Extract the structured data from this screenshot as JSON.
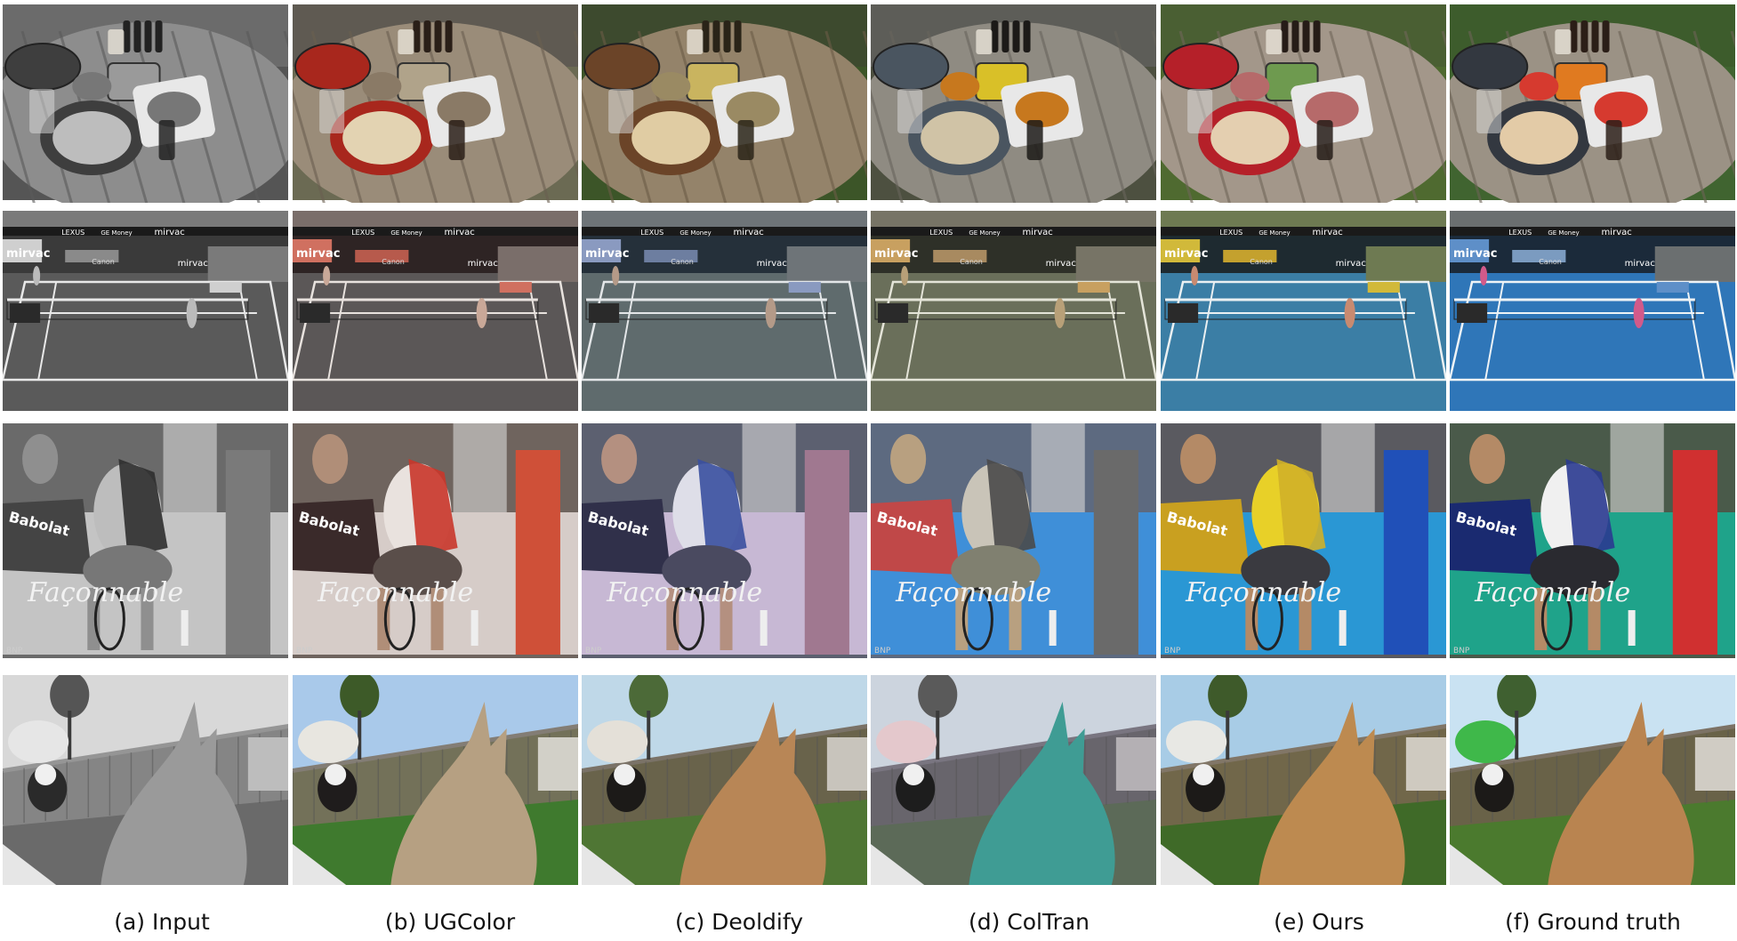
{
  "figure": {
    "columns": [
      {
        "caption": "(a) Input",
        "mode": "gray"
      },
      {
        "caption": "(b) UGColor",
        "mode": "ugcolor"
      },
      {
        "caption": "(c) Deoldify",
        "mode": "deoldify"
      },
      {
        "caption": "(d) ColTran",
        "mode": "coltran"
      },
      {
        "caption": "(e) Ours",
        "mode": "ours"
      },
      {
        "caption": "(f) Ground truth",
        "mode": "gt"
      }
    ],
    "rows": [
      {
        "scene": "food-table",
        "signage": []
      },
      {
        "scene": "tennis-court",
        "signage": [
          "LEXUS",
          "GE Money",
          "mirvac",
          "mirvac",
          "mirvac",
          "Canon"
        ]
      },
      {
        "scene": "tennis-player-bench",
        "signage": [
          "Babolat",
          "Façonnable",
          "BNP"
        ]
      },
      {
        "scene": "dogs-yard",
        "signage": []
      }
    ]
  }
}
